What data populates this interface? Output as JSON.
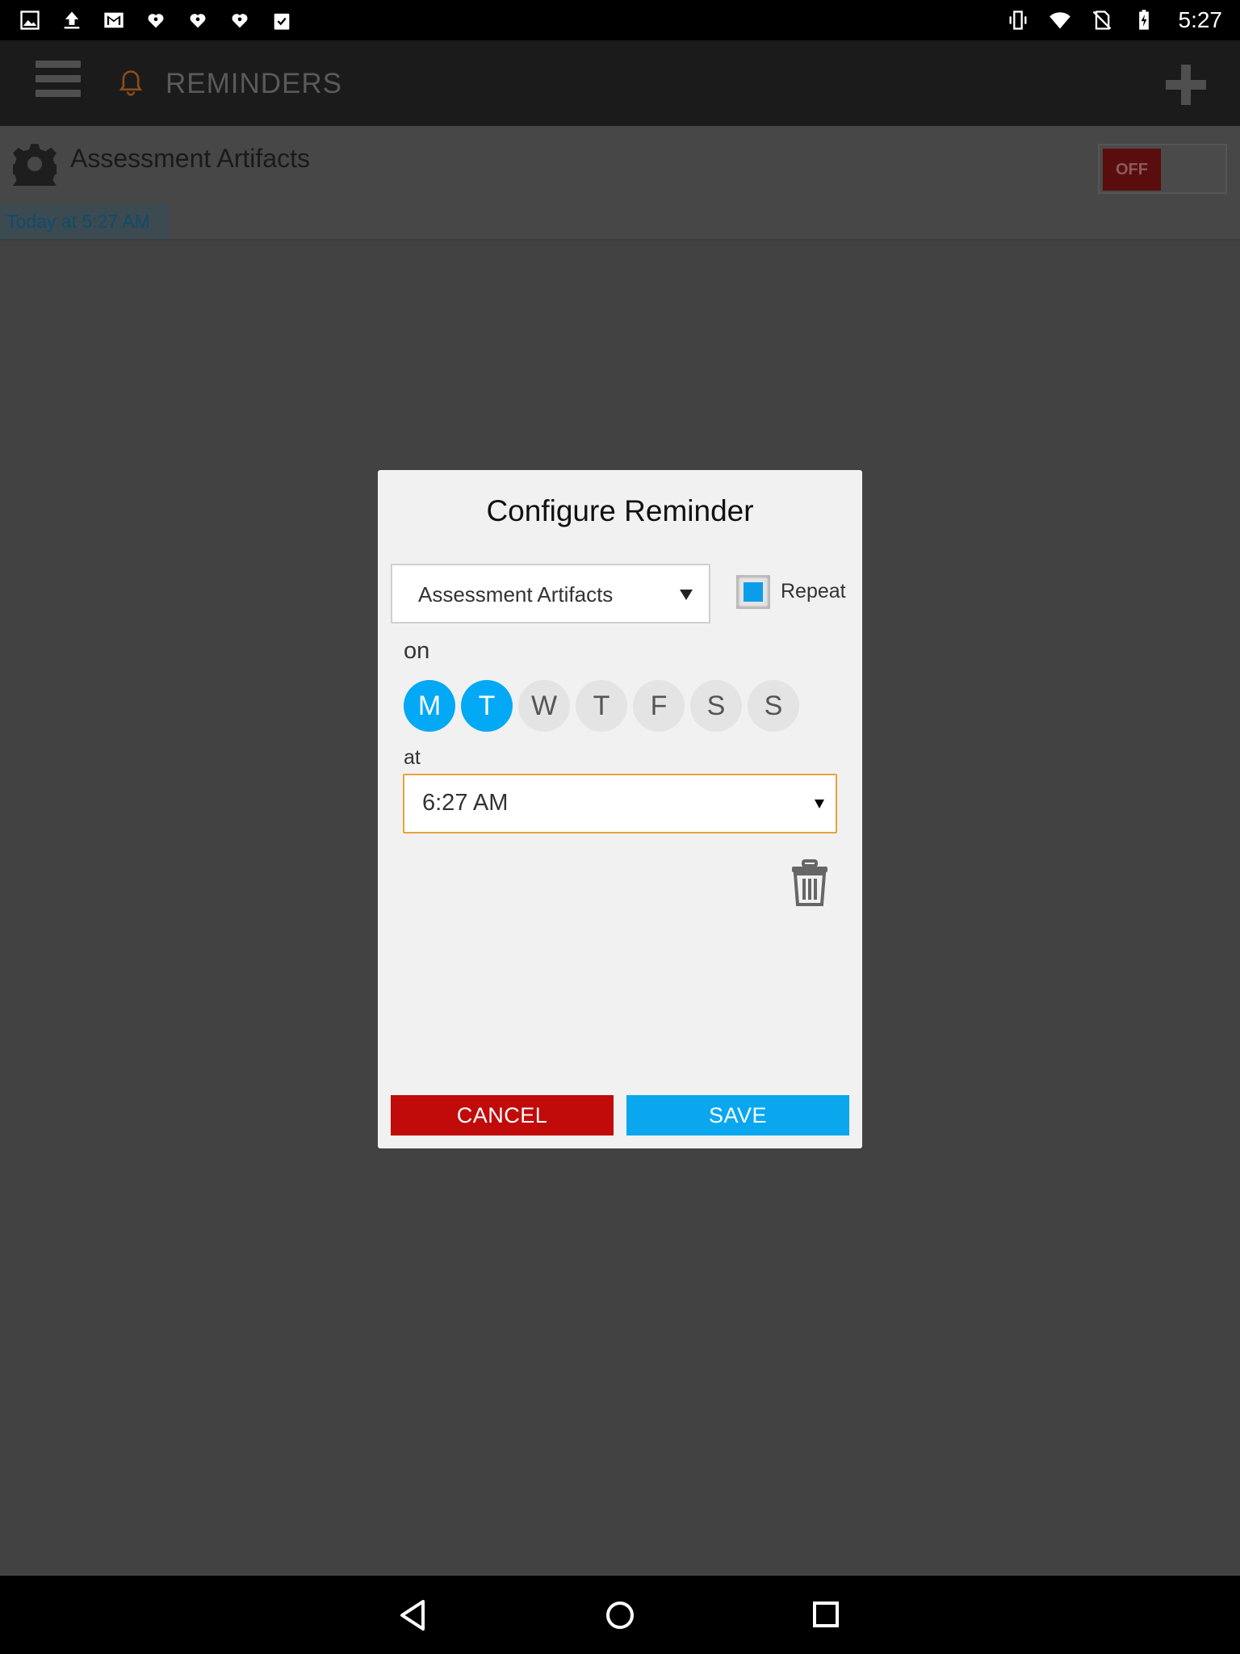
{
  "status_bar": {
    "time": "5:27",
    "left_icons": [
      "image-icon",
      "upload-icon",
      "gmail-icon",
      "iheartradio-icon",
      "iheartradio-icon",
      "iheartradio-icon",
      "clipboard-check-icon"
    ],
    "right_icons": [
      "vibrate-icon",
      "wifi-icon",
      "no-sim-icon",
      "battery-charging-icon"
    ]
  },
  "app_bar": {
    "title": "REMINDERS",
    "menu_icon": "hamburger-icon",
    "title_icon": "bell-icon",
    "action_icon": "plus-icon"
  },
  "reminder": {
    "name": "Assessment Artifacts",
    "toggle_label": "OFF",
    "time": "Today at 5:27 AM"
  },
  "dialog": {
    "title": "Configure Reminder",
    "item_select": "Assessment Artifacts",
    "repeat_label": "Repeat",
    "repeat_checked": true,
    "on_label": "on",
    "days": [
      {
        "label": "M",
        "selected": true
      },
      {
        "label": "T",
        "selected": true
      },
      {
        "label": "W",
        "selected": false
      },
      {
        "label": "T",
        "selected": false
      },
      {
        "label": "F",
        "selected": false
      },
      {
        "label": "S",
        "selected": false
      },
      {
        "label": "S",
        "selected": false
      }
    ],
    "at_label": "at",
    "time_value": "6:27 AM",
    "cancel_label": "CANCEL",
    "save_label": "SAVE"
  },
  "colors": {
    "accent": "#03a9f4",
    "cancel": "#c10b0b",
    "save": "#0aa7ee",
    "focus_border": "#e7a33e"
  }
}
